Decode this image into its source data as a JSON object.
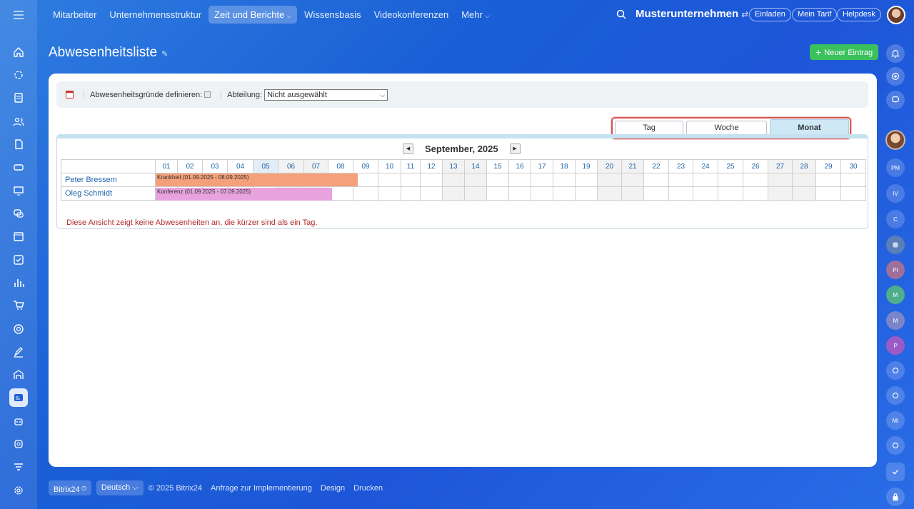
{
  "topnav": {
    "items": [
      {
        "label": "Mitarbeiter"
      },
      {
        "label": "Unternehmensstruktur"
      },
      {
        "label": "Zeit und Berichte",
        "active": true
      },
      {
        "label": "Wissensbasis"
      },
      {
        "label": "Videokonferenzen"
      },
      {
        "label": "Mehr"
      }
    ],
    "company": "Musterunternehmen",
    "invite": "Einladen",
    "plan": "Mein Tarif",
    "help": "Helpdesk"
  },
  "page": {
    "title": "Abwesenheitsliste",
    "new_entry": "Neuer Eintrag"
  },
  "filter": {
    "reasons_label": "Abwesenheitsgründe definieren:",
    "department_label": "Abteilung:",
    "department_value": "Nicht ausgewählt"
  },
  "tabs": {
    "day": "Tag",
    "week": "Woche",
    "month": "Monat"
  },
  "calendar": {
    "month": "September, 2025",
    "days": [
      "01",
      "02",
      "03",
      "04",
      "05",
      "06",
      "07",
      "08",
      "09",
      "10",
      "11",
      "12",
      "13",
      "14",
      "15",
      "16",
      "17",
      "18",
      "19",
      "20",
      "21",
      "22",
      "23",
      "24",
      "25",
      "26",
      "27",
      "28",
      "29",
      "30"
    ],
    "rows": [
      {
        "name": "Peter Bressem",
        "absence": "Krankheit (01.09.2025 - 08.09.2025)",
        "color": "#f4a07a"
      },
      {
        "name": "Oleg Schmidt",
        "absence": "Konferenz (01.09.2025 - 07.09.2025)",
        "color": "#e6a3dd"
      }
    ],
    "note": "Diese Ansicht zeigt keine Abwesenheiten an, die kürzer sind als ein Tag."
  },
  "right_bar": {
    "avatars": [
      "PM",
      "IV",
      "C",
      "PI",
      "M",
      "M",
      "P",
      "MI"
    ]
  },
  "footer": {
    "brand": "Bitrix24",
    "language": "Deutsch",
    "copyright": "© 2025 Bitrix24",
    "links": [
      "Anfrage zur Implementierung",
      "Design",
      "Drucken"
    ]
  }
}
